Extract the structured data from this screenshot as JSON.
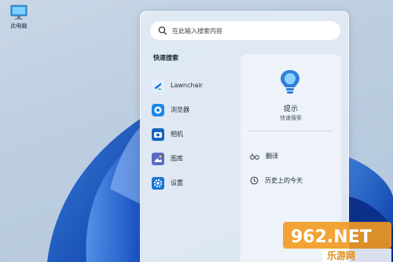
{
  "desktop": {
    "icon_label": "此电脑",
    "icon": "monitor-icon"
  },
  "search": {
    "placeholder": "在此输入搜索内容",
    "icon": "search-icon"
  },
  "quick_search": {
    "title": "快速搜索",
    "apps": [
      {
        "label": "Lawnchair",
        "icon": "lawnchair-icon",
        "color": "#1a73e8"
      },
      {
        "label": "浏览器",
        "icon": "browser-icon",
        "color": "#1e88e5"
      },
      {
        "label": "相机",
        "icon": "camera-icon",
        "color": "#1565c0"
      },
      {
        "label": "图库",
        "icon": "gallery-icon",
        "color": "#5c6bc0"
      },
      {
        "label": "设置",
        "icon": "settings-icon",
        "color": "#1976d2"
      }
    ]
  },
  "tip_card": {
    "title": "提示",
    "subtitle": "快速搜索",
    "icon": "lightbulb-icon",
    "actions": [
      {
        "label": "翻译",
        "icon": "translate-icon"
      },
      {
        "label": "历史上的今天",
        "icon": "history-icon"
      }
    ]
  },
  "watermark": {
    "brand": "962.NET",
    "sub": "乐游网"
  }
}
